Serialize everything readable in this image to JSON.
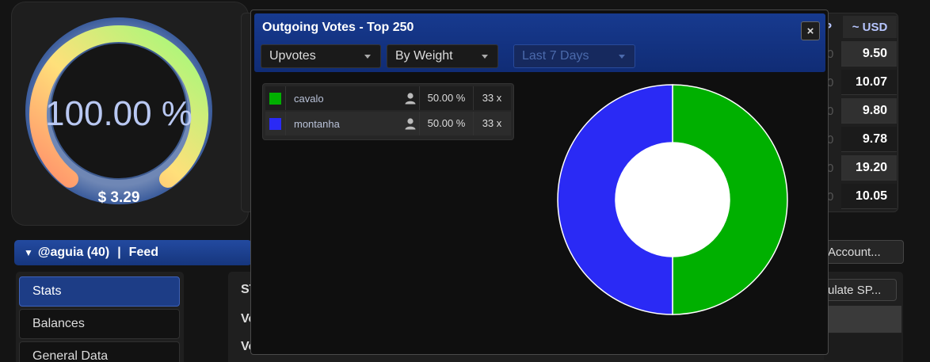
{
  "gauge": {
    "percent_text": "100.00 %",
    "value_text": "$ 3.29"
  },
  "table": {
    "header_partial": "P",
    "usd_header": "~ USD",
    "zero_partial": "0",
    "usd_values": [
      "9.50",
      "10.07",
      "9.80",
      "9.78",
      "19.20",
      "10.05"
    ]
  },
  "feed_bar": {
    "account": "@aguia (40)",
    "separator": "|",
    "feed": "Feed"
  },
  "account_button": "Account...",
  "calc_button": "ulate SP...",
  "side_nav": [
    "Stats",
    "Balances",
    "General Data"
  ],
  "main_labels": [
    "ST",
    "Vo",
    "Vo"
  ],
  "modal": {
    "title": "Outgoing Votes - Top 250",
    "close": "×",
    "filters": {
      "type": "Upvotes",
      "sort": "By Weight",
      "period": "Last 7 Days"
    },
    "legend": [
      {
        "name": "cavalo",
        "percent": "50.00 %",
        "count": "33 x",
        "color": "#00b000"
      },
      {
        "name": "montanha",
        "percent": "50.00 %",
        "count": "33 x",
        "color": "#2a2af5"
      }
    ]
  },
  "chart_data": {
    "type": "pie",
    "categories": [
      "cavalo",
      "montanha"
    ],
    "values": [
      50,
      50
    ],
    "colors": [
      "#00b000",
      "#2a2af5"
    ],
    "donut": true
  }
}
